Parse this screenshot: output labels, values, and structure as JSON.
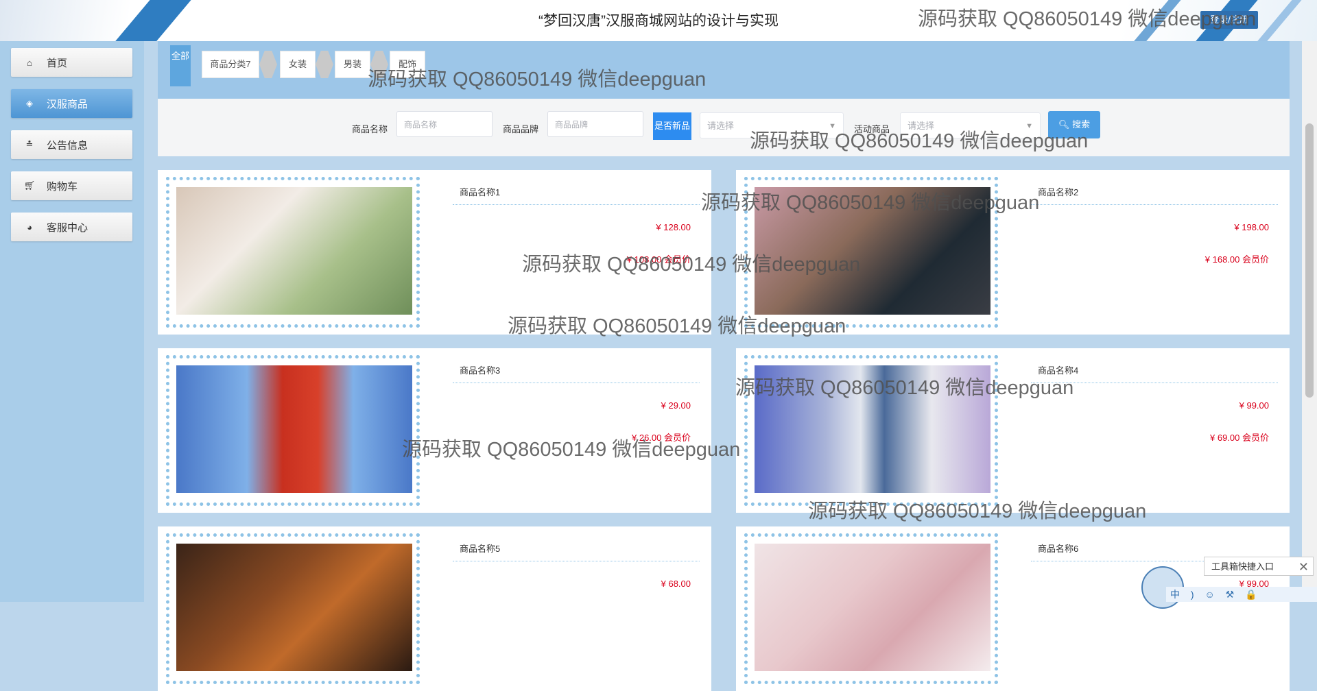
{
  "header": {
    "title": "“梦回汉唐”汉服商城网站的设计与实现",
    "login_label": "登录/注册"
  },
  "sidebar": {
    "items": [
      {
        "label": "首页",
        "icon": "home-icon"
      },
      {
        "label": "汉服商品",
        "icon": "cube-icon"
      },
      {
        "label": "公告信息",
        "icon": "sliders-icon"
      },
      {
        "label": "购物车",
        "icon": "cart-icon"
      },
      {
        "label": "客服中心",
        "icon": "support-icon"
      }
    ]
  },
  "categories": [
    "全部",
    "商品分类7",
    "女装",
    "男装",
    "配饰"
  ],
  "search": {
    "name_label": "商品名称",
    "name_placeholder": "商品名称",
    "brand_label": "商品品牌",
    "brand_placeholder": "商品品牌",
    "new_label": "是否新品",
    "new_placeholder": "请选择",
    "activity_label": "活动商品",
    "activity_placeholder": "请选择",
    "search_button": "搜索"
  },
  "products": [
    {
      "name": "商品名称1",
      "price": "¥ 128.00",
      "vip_price": "¥ 108.00 会员价"
    },
    {
      "name": "商品名称2",
      "price": "¥ 198.00",
      "vip_price": "¥ 168.00 会员价"
    },
    {
      "name": "商品名称3",
      "price": "¥ 29.00",
      "vip_price": "¥ 26.00 会员价"
    },
    {
      "name": "商品名称4",
      "price": "¥ 99.00",
      "vip_price": "¥ 69.00 会员价"
    },
    {
      "name": "商品名称5",
      "price": "¥ 68.00",
      "vip_price": ""
    },
    {
      "name": "商品名称6",
      "price": "¥ 99.00",
      "vip_price": ""
    }
  ],
  "watermark": "源码获取 QQ86050149 微信deepguan",
  "toolbox": {
    "label": "工具箱快捷入口"
  },
  "ime": {
    "text": "中 ) ☺ ⚒ 🔒"
  },
  "colors": {
    "accent": "#2d8cf0",
    "sidebar_active": "#4d95d4",
    "price": "#d9001b",
    "category_bar": "#9dc6e8"
  }
}
